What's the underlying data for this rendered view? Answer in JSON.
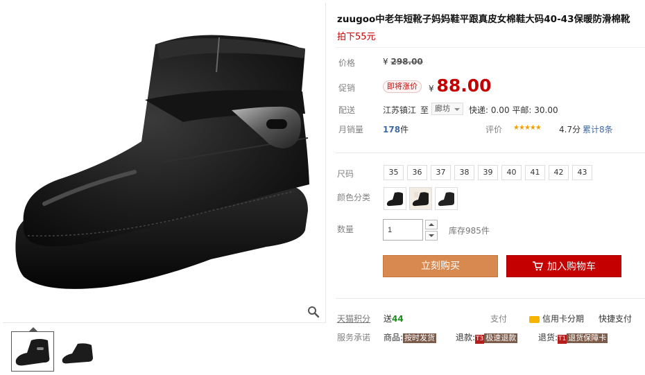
{
  "product": {
    "title": "zuugoo中老年短靴子妈妈鞋平跟真皮女棉鞋大码40-43保暖防滑棉靴",
    "subtitle": "拍下55元"
  },
  "price": {
    "label": "价格",
    "currency": "¥",
    "original": "298.00"
  },
  "promo": {
    "label": "促销",
    "tag": "即将涨价",
    "currency": "¥",
    "price": "88.00"
  },
  "delivery": {
    "label": "配送",
    "origin": "江苏镇江",
    "to": "至",
    "destination": "廊坊",
    "shipping": "快递: 0.00 平邮: 30.00"
  },
  "sales": {
    "label": "月销量",
    "count": "178",
    "unit": "件"
  },
  "rating": {
    "label": "评价",
    "score": "4.7分",
    "reviews": "累计8条",
    "stars": 4.7
  },
  "size": {
    "label": "尺码",
    "options": [
      "35",
      "36",
      "37",
      "38",
      "39",
      "40",
      "41",
      "42",
      "43"
    ]
  },
  "color": {
    "label": "颜色分类"
  },
  "quantity": {
    "label": "数量",
    "value": "1",
    "stock": "库存985件"
  },
  "actions": {
    "buy_now": "立刻购买",
    "add_to_cart": "加入购物车"
  },
  "tmall": {
    "points_label": "天猫积分",
    "points_prefix": "送",
    "points_value": "44",
    "pay_label": "支付",
    "credit": "信用卡分期",
    "quick_pay": "快捷支付"
  },
  "service": {
    "label": "服务承诺",
    "goods_label": "商品:",
    "goods_tag": "按时发货",
    "refund_label": "退款:",
    "refund_mark": "T3",
    "refund_tag": "极速退款",
    "return_label": "退货:",
    "return_mark": "T1",
    "return_tag": "退货保障卡"
  },
  "colors": {
    "accent": "#c40000",
    "buy_button": "#d8894f",
    "cart_button": "#c40000",
    "link": "#3c6aa7"
  }
}
